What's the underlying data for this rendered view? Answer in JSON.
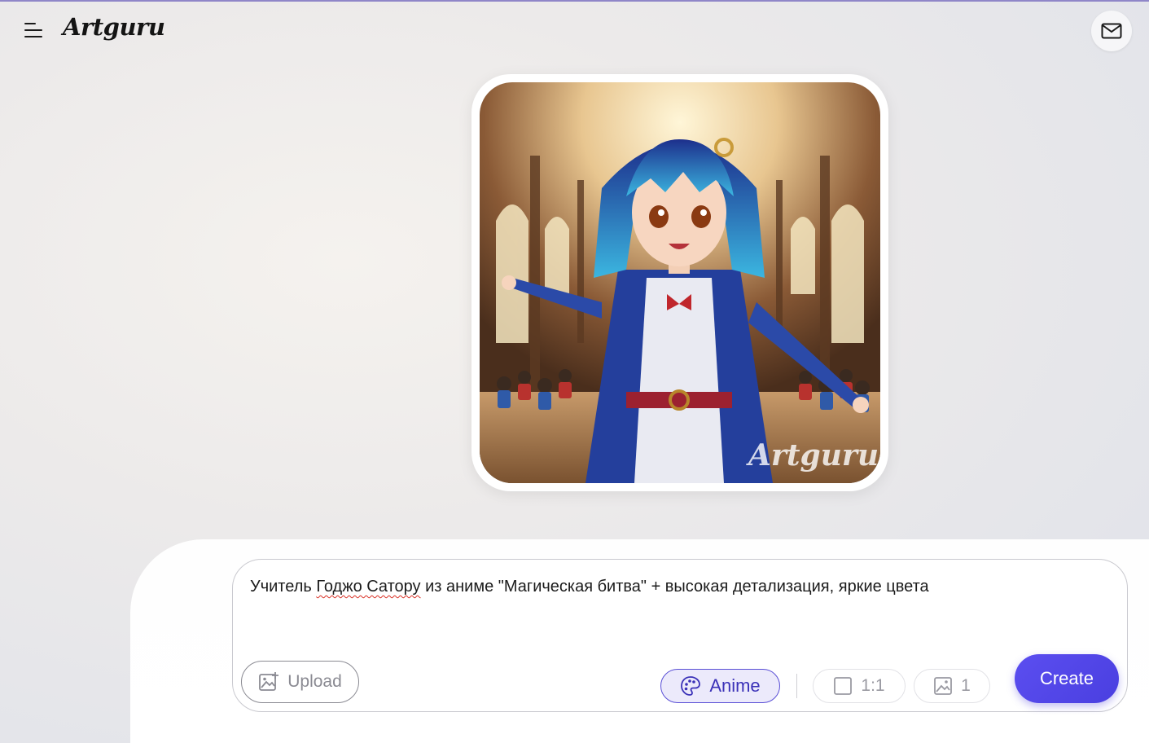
{
  "app": {
    "logo": "Artguru"
  },
  "header": {
    "menu_icon": "hamburger-icon",
    "mail_icon": "mail-icon"
  },
  "result": {
    "image_alt": "Generated anime illustration: blue-haired girl in blue and white uniform in a crowded hall",
    "watermark": "Artguru"
  },
  "prompt": {
    "before": "Учитель ",
    "misspelled": "Годжо Сатору",
    "after": " из аниме \"Магическая битва\" + высокая детализация, яркие цвета"
  },
  "toolbar": {
    "upload_label": "Upload",
    "style_label": "Anime",
    "ratio_label": "1:1",
    "count_label": "1",
    "create_label": "Create"
  },
  "colors": {
    "accent": "#4a3fe0",
    "style_chip_bg": "#eceafb",
    "top_line": "#8f86c8"
  }
}
